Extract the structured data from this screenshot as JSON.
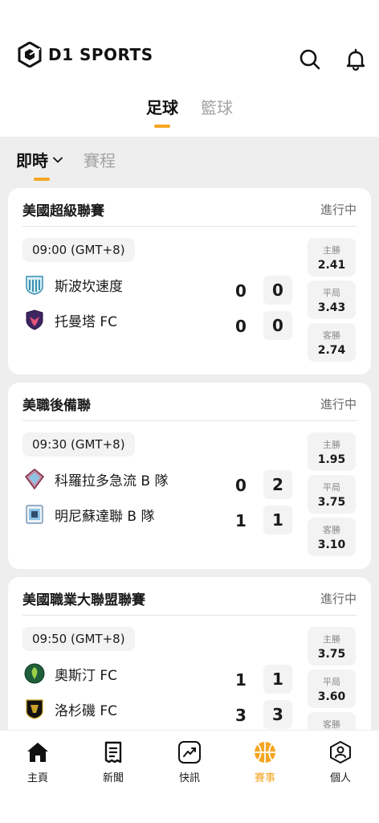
{
  "header": {
    "logo_text": "D1 SPORTS",
    "search_icon": "search-icon",
    "bell_icon": "bell-icon"
  },
  "sport_tabs": [
    {
      "label": "足球",
      "active": true
    },
    {
      "label": "籃球",
      "active": false
    }
  ],
  "sub_tabs": [
    {
      "label": "即時",
      "active": true
    },
    {
      "label": "賽程",
      "active": false
    }
  ],
  "colors": {
    "accent": "#f5a623",
    "background": "#eeeeee",
    "card": "#ffffff"
  },
  "matches": [
    {
      "league": "美國超級聯賽",
      "status": "進行中",
      "time": "09:00 (GMT+8)",
      "home": {
        "name": "斯波坎速度",
        "badge": "velocity-badge-icon",
        "score_a": "0",
        "score_b": "0"
      },
      "away": {
        "name": "托曼塔 FC",
        "badge": "tormenta-badge-icon",
        "score_a": "0",
        "score_b": "0"
      },
      "odds": [
        {
          "label": "主勝",
          "value": "2.41"
        },
        {
          "label": "平局",
          "value": "3.43"
        },
        {
          "label": "客勝",
          "value": "2.74"
        }
      ]
    },
    {
      "league": "美職後備聯",
      "status": "進行中",
      "time": "09:30 (GMT+8)",
      "home": {
        "name": "科羅拉多急流 B 隊",
        "badge": "rapids-badge-icon",
        "score_a": "0",
        "score_b": "2"
      },
      "away": {
        "name": "明尼蘇達聯 B 隊",
        "badge": "mnufc-badge-icon",
        "score_a": "1",
        "score_b": "1"
      },
      "odds": [
        {
          "label": "主勝",
          "value": "1.95"
        },
        {
          "label": "平局",
          "value": "3.75"
        },
        {
          "label": "客勝",
          "value": "3.10"
        }
      ]
    },
    {
      "league": "美國職業大聯盟聯賽",
      "status": "進行中",
      "time": "09:50 (GMT+8)",
      "home": {
        "name": "奧斯汀 FC",
        "badge": "austin-badge-icon",
        "score_a": "1",
        "score_b": "1"
      },
      "away": {
        "name": "洛杉磯 FC",
        "badge": "lafc-badge-icon",
        "score_a": "3",
        "score_b": "3"
      },
      "odds": [
        {
          "label": "主勝",
          "value": "3.75"
        },
        {
          "label": "平局",
          "value": "3.60"
        },
        {
          "label": "客勝",
          "value": ""
        }
      ]
    }
  ],
  "bottom_nav": [
    {
      "label": "主頁",
      "icon": "home-icon",
      "active": false
    },
    {
      "label": "新聞",
      "icon": "news-icon",
      "active": false
    },
    {
      "label": "快訊",
      "icon": "flash-icon",
      "active": false
    },
    {
      "label": "賽事",
      "icon": "basketball-icon",
      "active": true
    },
    {
      "label": "個人",
      "icon": "profile-icon",
      "active": false
    }
  ]
}
